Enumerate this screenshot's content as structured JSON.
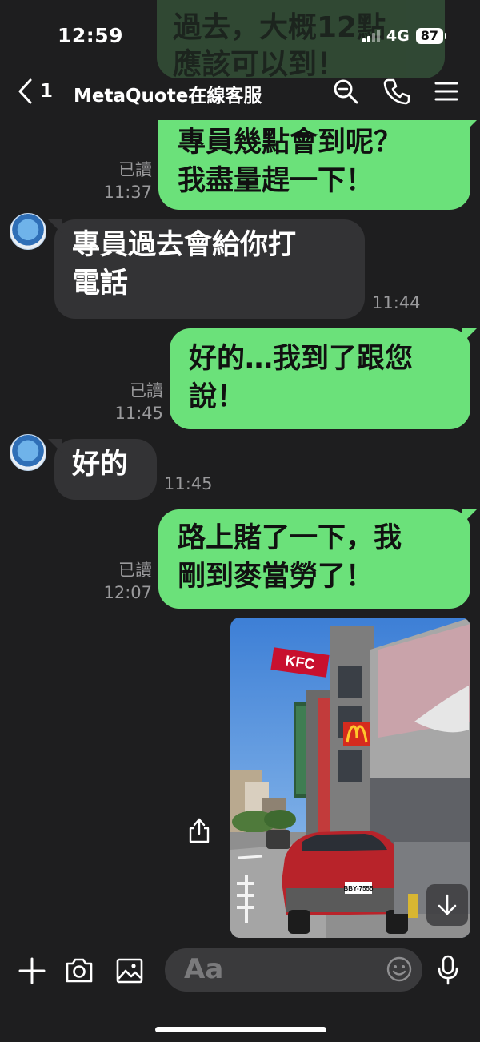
{
  "status_bar": {
    "time": "12:59",
    "network": "4G",
    "battery": "87"
  },
  "header": {
    "back_count": "1",
    "title": "MetaQuote在線客服"
  },
  "messages": [
    {
      "side": "out",
      "text_lines": [
        "專員幾點會到呢？",
        "我盡量趕一下！"
      ],
      "read_label": "已讀",
      "time": "11:37"
    },
    {
      "side": "in",
      "text_lines": [
        "專員過去會給你打",
        "電話"
      ],
      "time": "11:44"
    },
    {
      "side": "out",
      "text_lines": [
        "好的…我到了跟您",
        "說！"
      ],
      "read_label": "已讀",
      "time": "11:45"
    },
    {
      "side": "in",
      "text_lines": [
        "好的"
      ],
      "time": "11:45"
    },
    {
      "side": "out",
      "text_lines": [
        "路上賭了一下，我",
        "剛到麥當勞了！"
      ],
      "read_label": "已讀",
      "time": "12:07"
    }
  ],
  "photo": {
    "signs": {
      "kfc": "KFC",
      "plate": "BBY-7555",
      "road_text": "出口"
    }
  },
  "input": {
    "placeholder": "Aa"
  },
  "background_peek": [
    "過去，大概12點",
    "應該可以到！"
  ],
  "colors": {
    "out_bubble": "#6be17a",
    "in_bubble": "#333335",
    "background": "#1e1e1f"
  },
  "icons": [
    "back-chevron-icon",
    "search-icon",
    "phone-icon",
    "menu-icon",
    "plus-icon",
    "camera-icon",
    "image-icon",
    "emoji-icon",
    "mic-icon",
    "share-icon",
    "scroll-down-icon"
  ]
}
